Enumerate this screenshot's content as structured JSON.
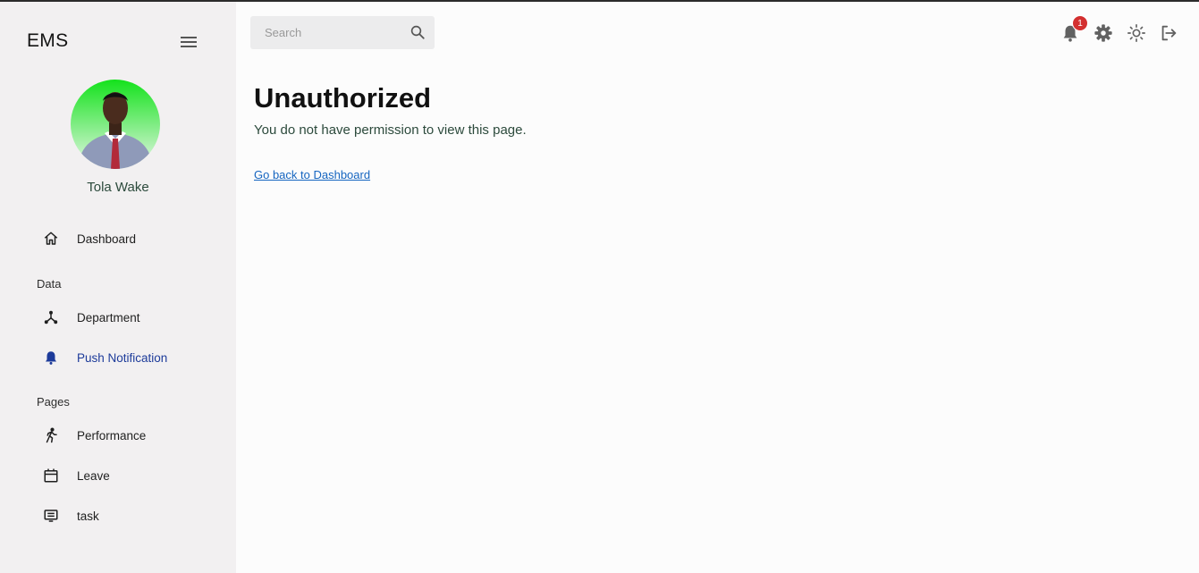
{
  "app": {
    "brand": "EMS"
  },
  "user": {
    "name": "Tola Wake"
  },
  "sidebar": {
    "items": [
      {
        "label": "Dashboard",
        "icon": "home-icon"
      },
      {
        "label": "Department",
        "icon": "department-icon"
      },
      {
        "label": "Push Notification",
        "icon": "bell-icon",
        "active": true
      },
      {
        "label": "Performance",
        "icon": "run-icon"
      },
      {
        "label": "Leave",
        "icon": "calendar-icon"
      },
      {
        "label": "task",
        "icon": "task-icon"
      }
    ],
    "sections": {
      "data": "Data",
      "pages": "Pages"
    }
  },
  "header": {
    "search_placeholder": "Search",
    "notification_count": "1"
  },
  "main": {
    "title": "Unauthorized",
    "message": "You do not have permission to view this page.",
    "link": "Go back to Dashboard"
  },
  "colors": {
    "sidebar_bg": "#f2f0f1",
    "active": "#1d3b9a",
    "link": "#1565c0",
    "badge": "#d32f2f"
  }
}
